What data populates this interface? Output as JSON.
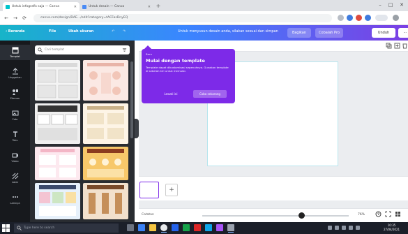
{
  "browser": {
    "tabs": [
      {
        "label": "Untuk infografis saja — Canva"
      },
      {
        "label": "Untuk desain — Canva"
      }
    ],
    "url": "canva.com/design/DAE.../edit?category=tACFasDnyEQ",
    "controls": {
      "new_tab": "+",
      "back": "←",
      "forward": "→",
      "reload": "⟳",
      "minimize": "–",
      "maximize": "□",
      "close": "✕"
    }
  },
  "app_header": {
    "home": "‹ Beranda",
    "file": "File",
    "resize": "Ubah ukuran",
    "undo": "↶",
    "redo": "↷",
    "title": "Untuk menyusun desain anda, silakan sesuai dan simpan",
    "upgrade": "Bagikan",
    "share": "Cobalah Pro",
    "download": "Unduh",
    "publish": "⋯"
  },
  "sidebar": {
    "items": [
      {
        "label": "Templat",
        "icon": "templates-icon"
      },
      {
        "label": "Unggahan",
        "icon": "upload-icon"
      },
      {
        "label": "Elemen",
        "icon": "elements-icon"
      },
      {
        "label": "Foto",
        "icon": "photos-icon"
      },
      {
        "label": "Teks",
        "icon": "text-icon"
      },
      {
        "label": "Video",
        "icon": "video-icon"
      },
      {
        "label": "Latar",
        "icon": "background-icon"
      },
      {
        "label": "Lainnya",
        "icon": "more-icon"
      }
    ]
  },
  "panel": {
    "search_placeholder": "Cari templat"
  },
  "tooltip": {
    "badge": "Baru",
    "title": "Mulai dengan template",
    "body": "Template dapat dikustomisasi sepenuhnya. Gunakan template di sebelah kiri untuk memulai.",
    "button_primary": "Lewati ini",
    "button_secondary": "Coba sekarang"
  },
  "editor": {
    "add_page": "+",
    "notes": "Catatan",
    "zoom": "76%"
  },
  "taskbar": {
    "search_placeholder": "Type here to search",
    "time": "10:35",
    "date": "27/04/2021"
  },
  "colors": {
    "accent": "#7d2ae8",
    "header_start": "#17b4c8",
    "sidebar_bg": "#17191d",
    "panel_bg": "#292c31"
  }
}
